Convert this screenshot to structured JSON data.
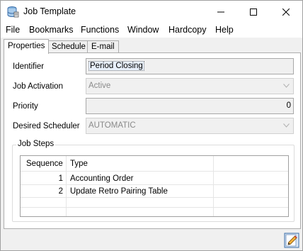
{
  "window": {
    "title": "Job Template",
    "minimize_symbol": "—",
    "maximize_symbol": "☐",
    "close_symbol": "✕",
    "app_icon": "database-icon"
  },
  "menu": {
    "items": [
      "File",
      "Bookmarks",
      "Functions",
      "Window",
      "Hardcopy",
      "Help"
    ]
  },
  "tabs": [
    {
      "label": "Properties",
      "active": true
    },
    {
      "label": "Schedule",
      "active": false
    },
    {
      "label": "E-mail",
      "active": false
    }
  ],
  "form": {
    "identifier_label": "Identifier",
    "identifier_value": "Period Closing",
    "job_activation_label": "Job Activation",
    "job_activation_value": "Active",
    "priority_label": "Priority",
    "priority_value": "0",
    "desired_scheduler_label": "Desired Scheduler",
    "desired_scheduler_value": "AUTOMATIC"
  },
  "job_steps": {
    "group_title": "Job Steps",
    "columns": [
      "Sequence",
      "Type"
    ],
    "rows": [
      {
        "sequence": "1",
        "type": "Accounting Order"
      },
      {
        "sequence": "2",
        "type": "Update Retro Pairing Table"
      }
    ]
  },
  "statusbar": {
    "edit_icon": "pencil-edit-icon"
  },
  "colors": {
    "titlebar_bg": "#ffffff",
    "window_bg": "#f0f0f0",
    "panel_bg": "#ffffff",
    "disabled_text": "#8a8a8a"
  }
}
